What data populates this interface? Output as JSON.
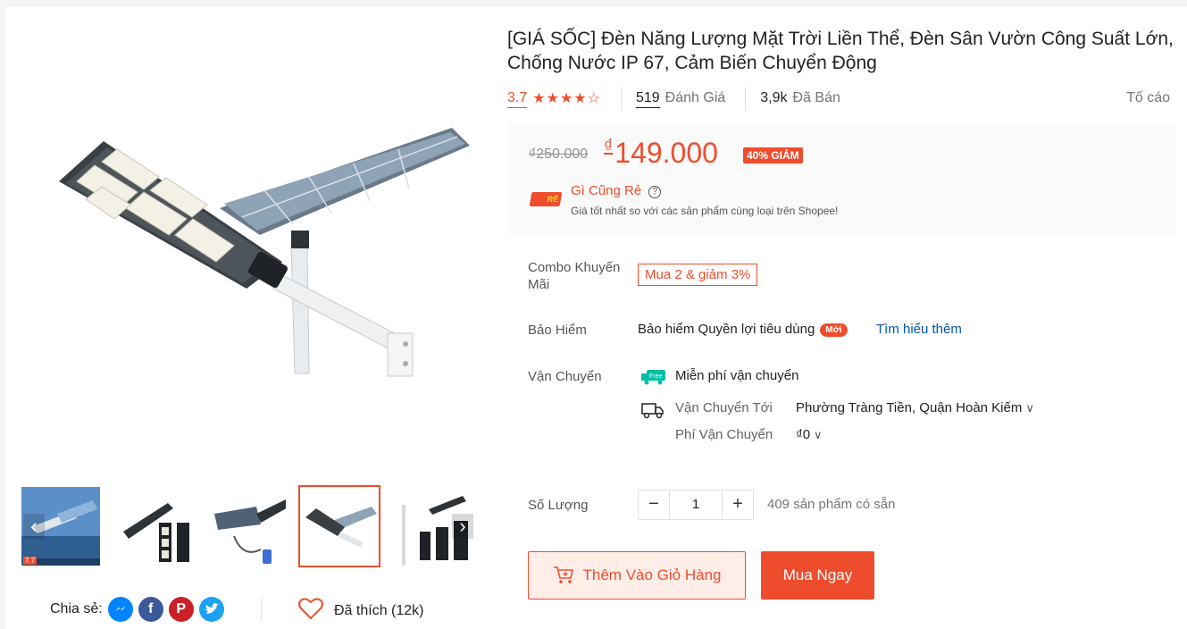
{
  "product": {
    "title": "[GIÁ SỐC] Đèn Năng Lượng Mặt Trời Liền Thể, Đèn Sân Vườn Công Suất Lớn, Chống Nước IP 67, Cảm Biến Chuyển Động",
    "rating": "3.7",
    "stars": "★★★★☆",
    "reviews_count": "519",
    "reviews_label": "Đánh Giá",
    "sold_count": "3,9k",
    "sold_label": "Đã Bán",
    "report_label": "Tố cáo"
  },
  "price": {
    "old": "₫250.000",
    "currency": "₫",
    "new": "149.000",
    "discount": "40% GIẢM"
  },
  "cheap": {
    "logo_text": "RẺ",
    "title": "Gì Cũng Rẻ",
    "help": "?",
    "desc": "Giá tốt nhất so với các sản phẩm cùng loại trên Shopee!"
  },
  "combo": {
    "label": "Combo Khuyến Mãi",
    "tag": "Mua 2 & giảm 3%"
  },
  "insurance": {
    "label": "Bảo Hiểm",
    "text": "Bảo hiểm Quyền lợi tiêu dùng",
    "badge": "Mới",
    "link": "Tìm hiểu thêm"
  },
  "shipping": {
    "label": "Vận Chuyển",
    "free": "Miễn phí vận chuyển",
    "free_icon_text": "Free",
    "to_label": "Vận Chuyển Tới",
    "to_value": "Phường Tràng Tiền, Quận Hoàn Kiếm",
    "fee_label": "Phí Vận Chuyển",
    "fee_value": "₫0",
    "chevron": "∨"
  },
  "quantity": {
    "label": "Số Lượng",
    "minus": "−",
    "value": "1",
    "plus": "+",
    "stock": "409 sản phẩm có sẵn"
  },
  "actions": {
    "add_to_cart": "Thêm Vào Giỏ Hàng",
    "buy_now": "Mua Ngay"
  },
  "share": {
    "label": "Chia sẻ:",
    "icons": [
      "messenger-icon",
      "facebook-icon",
      "pinterest-icon",
      "twitter-icon"
    ]
  },
  "like": {
    "label": "Đã thích (12k)"
  },
  "gallery": {
    "thumb_badge": "7.7",
    "arrow_left": "‹",
    "arrow_right": "›",
    "thumbnails": [
      "thumb-1",
      "thumb-2",
      "thumb-3",
      "thumb-4",
      "thumb-5"
    ],
    "active_index": 3
  },
  "colors": {
    "accent": "#ee4d2d",
    "link": "#0055aa",
    "messenger": "#0084ff",
    "facebook": "#3b5998",
    "pinterest": "#cb2027",
    "twitter": "#1da1f2"
  }
}
